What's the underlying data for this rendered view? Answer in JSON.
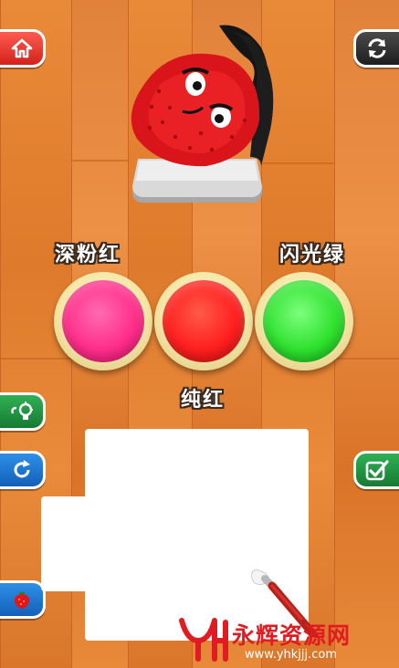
{
  "paints": [
    {
      "label": "深粉红",
      "color": "#ff2e8a"
    },
    {
      "label": "纯红",
      "color": "#ff1f1f"
    },
    {
      "label": "闪光绿",
      "color": "#2fe12f"
    }
  ],
  "target": {
    "icon": "strawberry-character"
  },
  "buttons": {
    "home": {
      "icon": "home-icon"
    },
    "restart": {
      "icon": "restart-icon"
    },
    "hint": {
      "icon": "lightbulb-hint-icon"
    },
    "refresh": {
      "icon": "refresh-icon"
    },
    "confirm": {
      "icon": "checkmark-icon"
    },
    "reference": {
      "icon": "strawberry-icon"
    }
  },
  "watermark": {
    "brand": "永辉资源网",
    "url": "www.yhkjjj.com",
    "color": "#e11b22"
  },
  "colors": {
    "wood": "#e0802f",
    "pot_rim": "#f5e6a6",
    "canvas": "#ffffff"
  }
}
